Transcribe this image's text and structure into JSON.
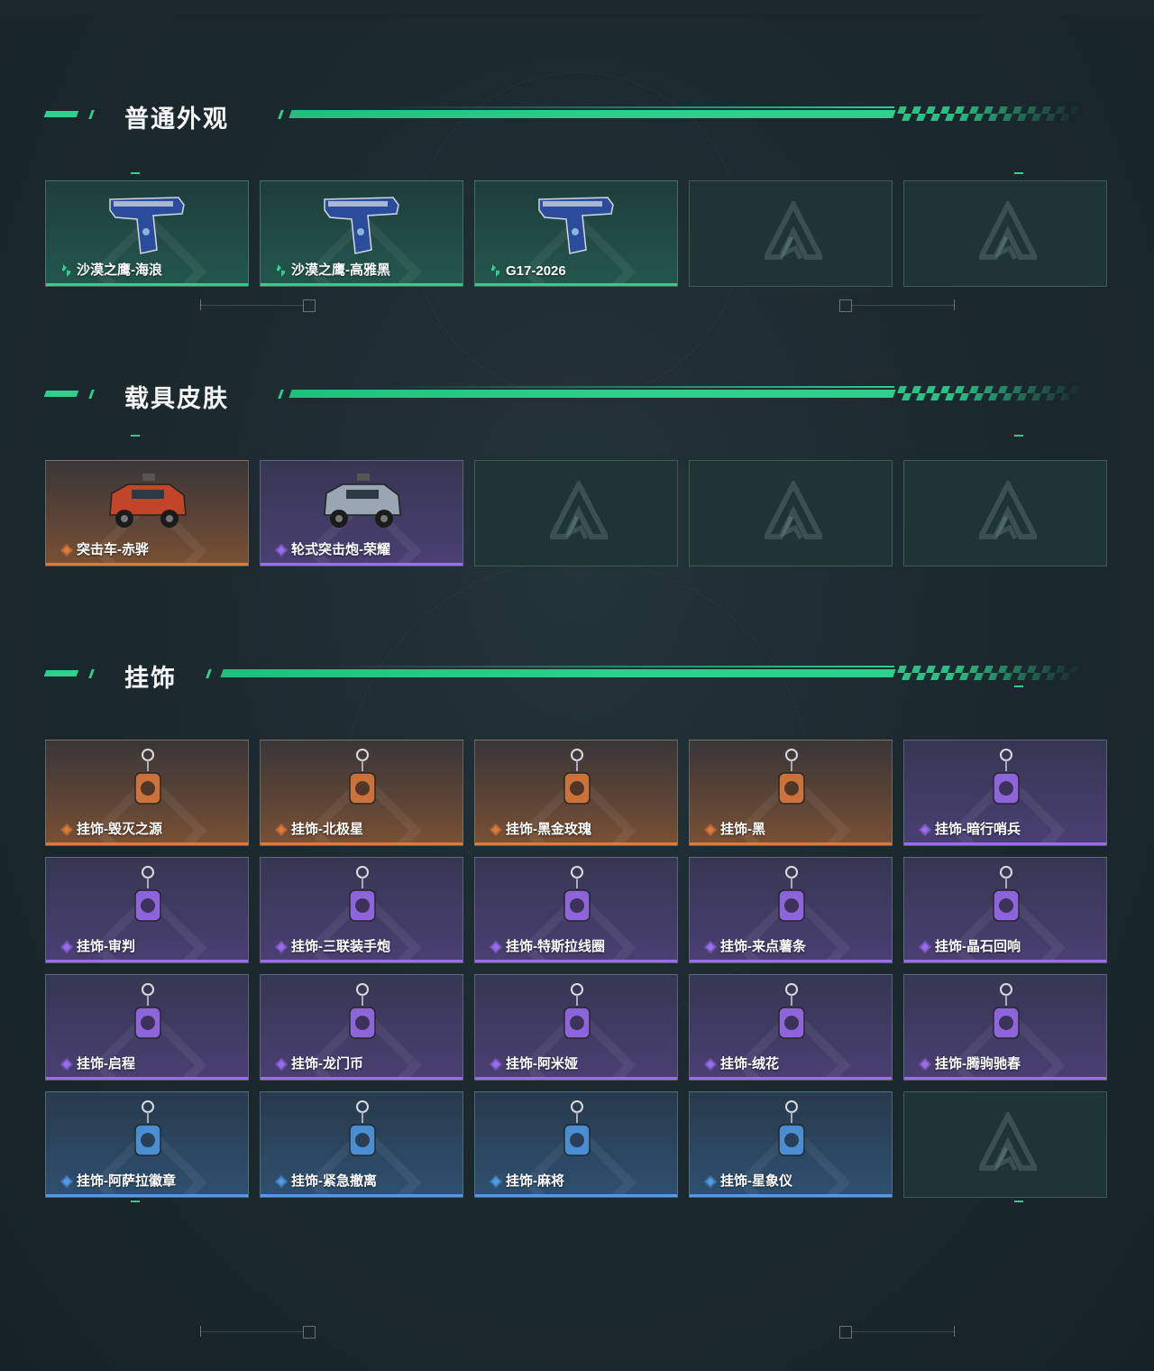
{
  "sections": [
    {
      "title": "普通外观",
      "items": [
        {
          "label": "沙漠之鹰-海浪",
          "rarity": "green",
          "icon": "pistol-icon"
        },
        {
          "label": "沙漠之鹰-高雅黑",
          "rarity": "green",
          "icon": "pistol-icon"
        },
        {
          "label": "G17-2026",
          "rarity": "green",
          "icon": "pistol-icon"
        },
        {
          "label": "",
          "rarity": "empty",
          "icon": "empty-slot-logo-icon"
        },
        {
          "label": "",
          "rarity": "empty",
          "icon": "empty-slot-logo-icon"
        }
      ]
    },
    {
      "title": "载具皮肤",
      "items": [
        {
          "label": "突击车-赤骅",
          "rarity": "orange",
          "icon": "vehicle-icon"
        },
        {
          "label": "轮式突击炮-荣耀",
          "rarity": "purple",
          "icon": "vehicle-icon"
        },
        {
          "label": "",
          "rarity": "empty",
          "icon": "empty-slot-logo-icon"
        },
        {
          "label": "",
          "rarity": "empty",
          "icon": "empty-slot-logo-icon"
        },
        {
          "label": "",
          "rarity": "empty",
          "icon": "empty-slot-logo-icon"
        }
      ]
    },
    {
      "title": "挂饰",
      "items": [
        {
          "label": "挂饰-毁灭之源",
          "rarity": "orange",
          "icon": "charm-icon"
        },
        {
          "label": "挂饰-北极星",
          "rarity": "orange",
          "icon": "charm-icon"
        },
        {
          "label": "挂饰-黑金玫瑰",
          "rarity": "orange",
          "icon": "charm-icon"
        },
        {
          "label": "挂饰-黑",
          "rarity": "orange",
          "icon": "charm-icon"
        },
        {
          "label": "挂饰-暗行哨兵",
          "rarity": "purple",
          "icon": "charm-icon"
        },
        {
          "label": "挂饰-审判",
          "rarity": "purple",
          "icon": "charm-icon"
        },
        {
          "label": "挂饰-三联装手炮",
          "rarity": "purple",
          "icon": "charm-icon"
        },
        {
          "label": "挂饰-特斯拉线圈",
          "rarity": "purple",
          "icon": "charm-icon"
        },
        {
          "label": "挂饰-来点薯条",
          "rarity": "purple",
          "icon": "charm-icon"
        },
        {
          "label": "挂饰-晶石回响",
          "rarity": "purple",
          "icon": "charm-icon"
        },
        {
          "label": "挂饰-启程",
          "rarity": "purple",
          "icon": "charm-icon"
        },
        {
          "label": "挂饰-龙门币",
          "rarity": "purple",
          "icon": "charm-icon"
        },
        {
          "label": "挂饰-阿米娅",
          "rarity": "purple",
          "icon": "charm-icon"
        },
        {
          "label": "挂饰-绒花",
          "rarity": "purple",
          "icon": "charm-icon"
        },
        {
          "label": "挂饰-腾驹驰春",
          "rarity": "purple",
          "icon": "charm-icon"
        },
        {
          "label": "挂饰-阿萨拉徽章",
          "rarity": "blue",
          "icon": "charm-icon"
        },
        {
          "label": "挂饰-紧急撤离",
          "rarity": "blue",
          "icon": "charm-icon"
        },
        {
          "label": "挂饰-麻将",
          "rarity": "blue",
          "icon": "charm-icon"
        },
        {
          "label": "挂饰-星象仪",
          "rarity": "blue",
          "icon": "charm-icon"
        },
        {
          "label": "",
          "rarity": "empty",
          "icon": "empty-slot-logo-icon"
        }
      ]
    }
  ],
  "colors": {
    "accent": "#2fd08c",
    "green": "#2fd08c",
    "orange": "#e07a3a",
    "purple": "#9b6cf0",
    "blue": "#4f9be6"
  }
}
